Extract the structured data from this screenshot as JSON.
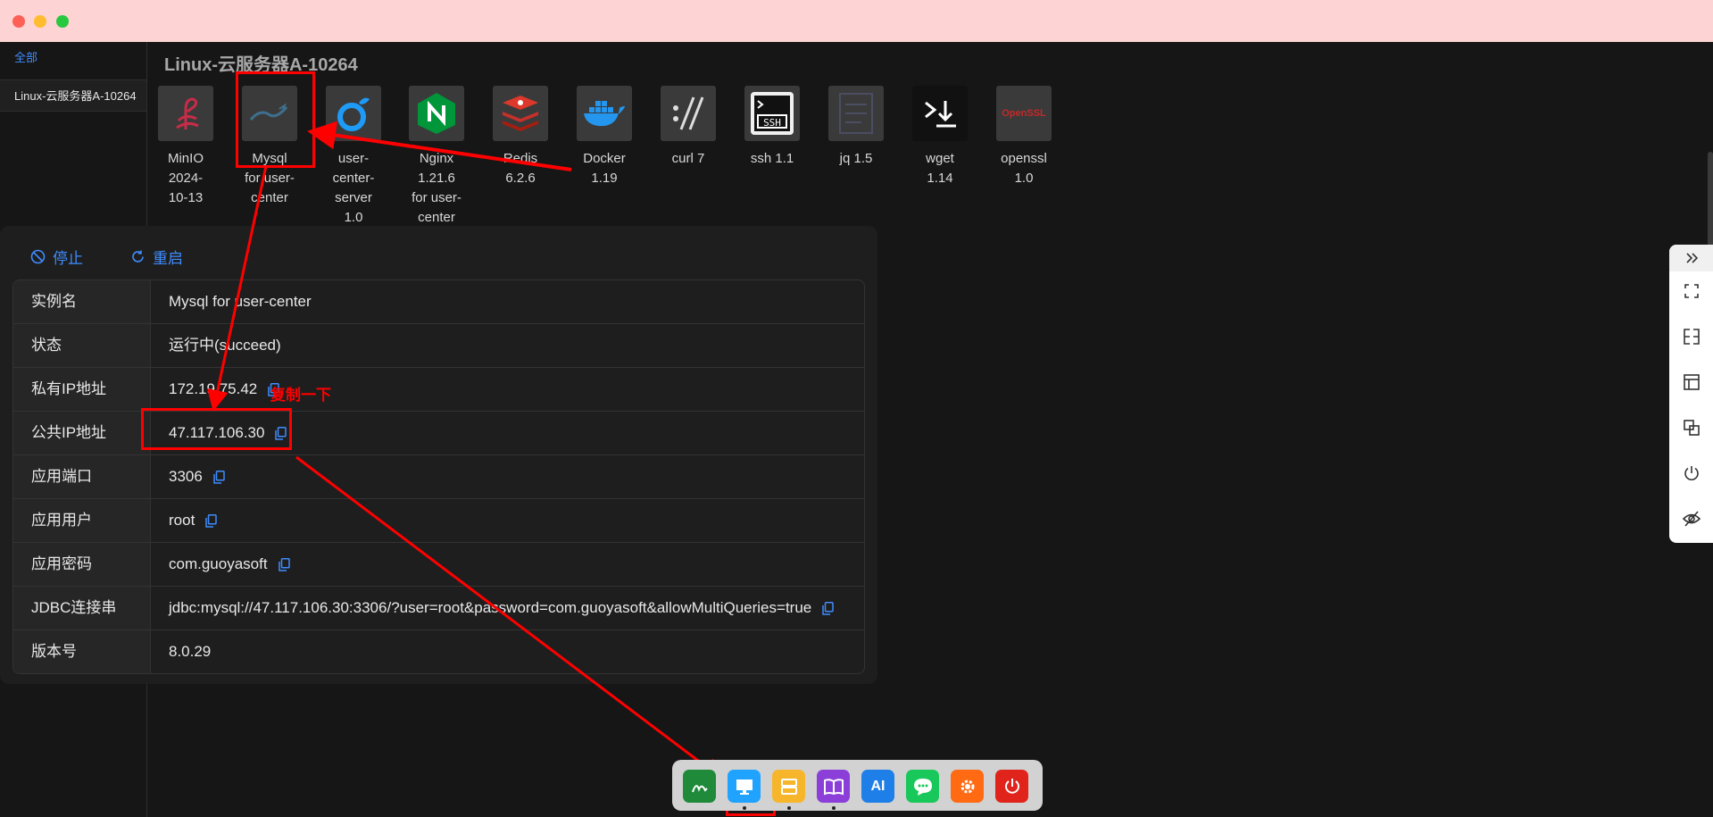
{
  "sidebar": {
    "items": [
      {
        "label": "全部"
      },
      {
        "label": "Linux-云服务器A-10264"
      }
    ]
  },
  "server_title": "Linux-云服务器A-10264",
  "apps": [
    {
      "label": "MinIO 2024-10-13",
      "icon": "minio-icon"
    },
    {
      "label": "Mysql for user-center",
      "icon": "mysql-icon"
    },
    {
      "label": "user-center-server 1.0",
      "icon": "user-center-server-icon"
    },
    {
      "label": "Nginx 1.21.6 for user-center",
      "icon": "nginx-icon"
    },
    {
      "label": "Redis 6.2.6",
      "icon": "redis-icon"
    },
    {
      "label": "Docker 1.19",
      "icon": "docker-icon"
    },
    {
      "label": "curl 7",
      "icon": "curl-icon"
    },
    {
      "label": "ssh 1.1",
      "icon": "ssh-icon"
    },
    {
      "label": "jq 1.5",
      "icon": "jq-icon"
    },
    {
      "label": "wget 1.14",
      "icon": "wget-icon"
    },
    {
      "label": "openssl 1.0",
      "icon": "openssl-icon",
      "logo_text": "OpenSSL"
    }
  ],
  "panel": {
    "stop_label": "停止",
    "restart_label": "重启",
    "rows": [
      {
        "key": "实例名",
        "value": "Mysql for user-center"
      },
      {
        "key": "状态",
        "value": "运行中(succeed)"
      },
      {
        "key": "私有IP地址",
        "value": "172.19.75.42"
      },
      {
        "key": "公共IP地址",
        "value": "47.117.106.30"
      },
      {
        "key": "应用端口",
        "value": "3306"
      },
      {
        "key": "应用用户",
        "value": "root"
      },
      {
        "key": "应用密码",
        "value": "com.guoyasoft"
      },
      {
        "key": "JDBC连接串",
        "value": "jdbc:mysql://47.117.106.30:3306/?user=root&password=com.guoyasoft&allowMultiQueries=true"
      },
      {
        "key": "版本号",
        "value": "8.0.29"
      }
    ]
  },
  "annotation": {
    "text": "复制一下"
  },
  "dock": {
    "items": [
      {
        "name": "sign-icon"
      },
      {
        "name": "monitor-icon"
      },
      {
        "name": "server-icon"
      },
      {
        "name": "book-icon"
      },
      {
        "name": "ai-icon",
        "label": "AI"
      },
      {
        "name": "chat-icon"
      },
      {
        "name": "settings-icon"
      },
      {
        "name": "power-icon"
      }
    ]
  },
  "colors": {
    "accent": "#3f8cff",
    "annotation": "#ff0000",
    "background": "#161616",
    "titlebar": "#fdd3d3"
  }
}
